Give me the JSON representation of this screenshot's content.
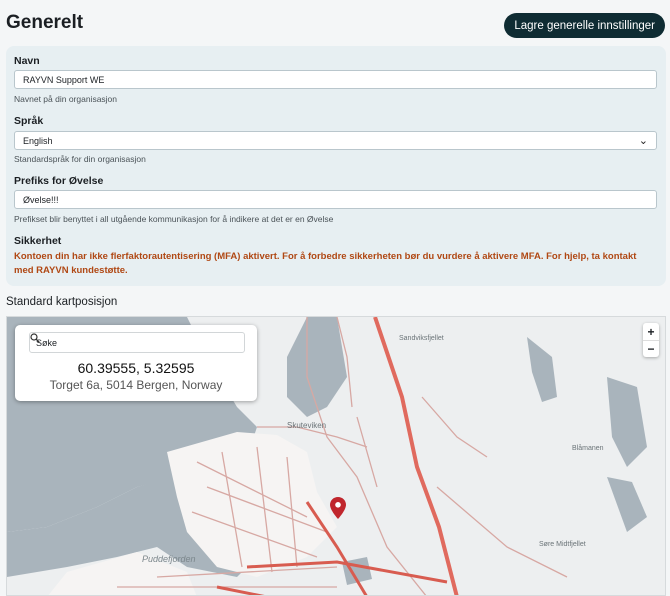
{
  "header": {
    "title": "Generelt",
    "save_label": "Lagre generelle innstillinger"
  },
  "form": {
    "name": {
      "label": "Navn",
      "value": "RAYVN Support WE",
      "hint": "Navnet på din organisasjon"
    },
    "language": {
      "label": "Språk",
      "value": "English",
      "hint": "Standardspråk for din organisasjon"
    },
    "prefix": {
      "label": "Prefiks for Øvelse",
      "value": "Øvelse!!!",
      "hint": "Prefikset blir benyttet i all utgående kommunikasjon for å indikere at det er en Øvelse"
    },
    "security": {
      "label": "Sikkerhet",
      "warning": "Kontoen din har ikke flerfaktorautentisering (MFA) aktivert. For å forbedre sikkerheten bør du vurdere å aktivere MFA. For hjelp, ta kontakt med RAYVN kundestøtte."
    }
  },
  "map": {
    "title": "Standard kartposisjon",
    "search_placeholder": "Søke",
    "coordinates": "60.39555, 5.32595",
    "address": "Torget 6a, 5014 Bergen, Norway",
    "zoom_in": "+",
    "zoom_out": "−",
    "labels": {
      "sandviksfjellet": "Sandviksfjellet",
      "skuteviken": "Skuteviken",
      "blamanen": "Blåmanen",
      "puddefjorden": "Puddefjorden",
      "midtfjellet": "Søre Midtfjellet"
    },
    "colors": {
      "water": "#a9b4bc",
      "road_major": "#e06a5e",
      "road_minor": "#d7a8a3",
      "pin": "#c0262d"
    }
  }
}
